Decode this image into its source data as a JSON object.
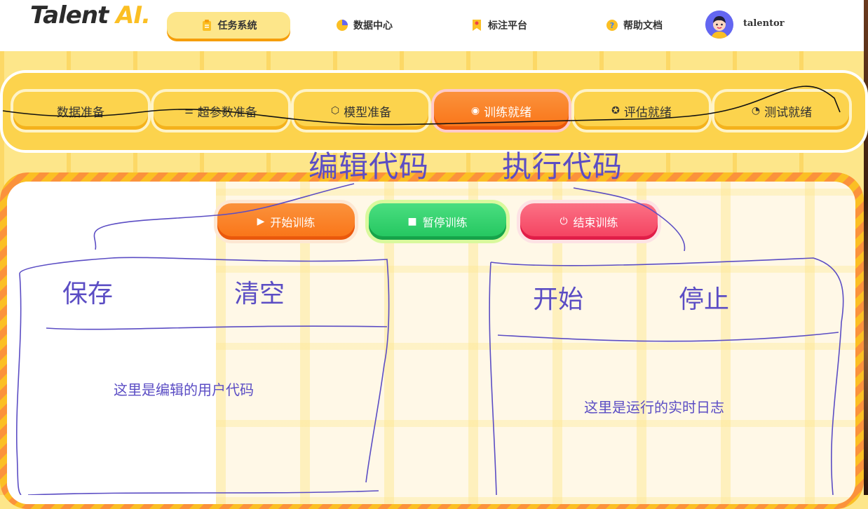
{
  "brand": {
    "name_main": "Talent",
    "name_accent": "AI."
  },
  "nav": {
    "items": [
      {
        "label": "任务系统",
        "icon": "clipboard-icon"
      },
      {
        "label": "数据中心",
        "icon": "pie-chart-icon"
      },
      {
        "label": "标注平台",
        "icon": "bookmark-icon"
      },
      {
        "label": "帮助文档",
        "icon": "help-icon"
      }
    ],
    "active_index": 0
  },
  "user": {
    "name": "talentor"
  },
  "stages": [
    {
      "label": "数据准备",
      "icon": ""
    },
    {
      "label": "超参数准备",
      "icon": "sliders-icon"
    },
    {
      "label": "模型准备",
      "icon": "cube-icon"
    },
    {
      "label": "训练就绪",
      "icon": "target-icon"
    },
    {
      "label": "评估就绪",
      "icon": "star-badge-icon"
    },
    {
      "label": "测试就绪",
      "icon": "gauge-icon"
    }
  ],
  "active_stage_index": 3,
  "controls": {
    "start_label": "开始训练",
    "pause_label": "暂停训练",
    "stop_label": "结束训练"
  },
  "sketch": {
    "edit_code_heading": "编辑代码",
    "run_code_heading": "执行代码",
    "save_label": "保存",
    "clear_label": "清空",
    "start_label": "开始",
    "stop_label": "停止",
    "editor_placeholder": "这里是编辑的用户代码",
    "log_placeholder": "这里是运行的实时日志"
  },
  "colors": {
    "accent_yellow": "#fcd34d",
    "active_orange": "#f97316",
    "pause_green": "#22c55e",
    "stop_red": "#f43f5e",
    "sketch_ink": "#5b4dc4"
  }
}
